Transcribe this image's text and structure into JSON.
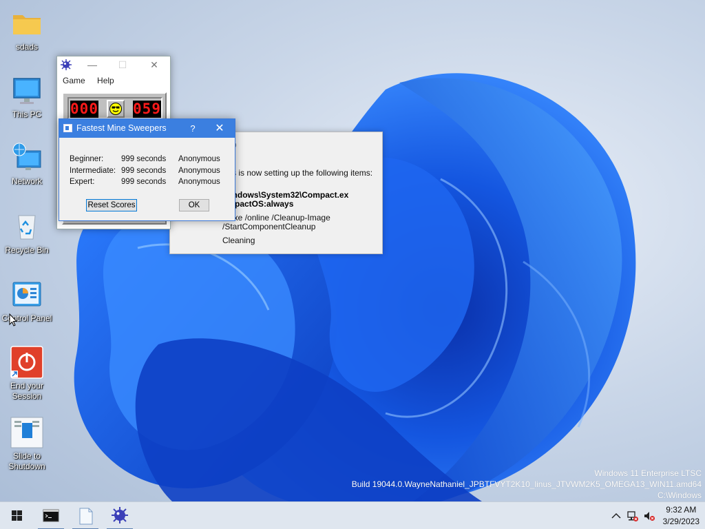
{
  "desktop": {
    "icons": [
      {
        "label": "sdads",
        "icon": "folder-icon"
      },
      {
        "label": "This PC",
        "icon": "monitor-icon"
      },
      {
        "label": "Network",
        "icon": "network-globe-icon"
      },
      {
        "label": "Recycle Bin",
        "icon": "recycle-bin-icon"
      },
      {
        "label": "Control Panel",
        "icon": "control-panel-icon"
      },
      {
        "label": "End your Session",
        "icon": "power-icon"
      },
      {
        "label": "Slide to Shutdown",
        "icon": "slide-shutdown-icon"
      }
    ]
  },
  "minesweeper": {
    "menu": [
      "Game",
      "Help"
    ],
    "mine_counter": "000",
    "timer": "059",
    "face": "cool-smiley-icon"
  },
  "scores_dialog": {
    "title": "Fastest Mine Sweepers",
    "help_glyph": "?",
    "rows": [
      {
        "level": "Beginner:",
        "time": "999 seconds",
        "name": "Anonymous"
      },
      {
        "level": "Intermediate:",
        "time": "999 seconds",
        "name": "Anonymous"
      },
      {
        "level": "Expert:",
        "time": "999 seconds",
        "name": "Anonymous"
      }
    ],
    "reset_label": "Reset Scores",
    "ok_label": "OK"
  },
  "cleanup_dialog": {
    "title_fragment": "p",
    "intro": "s is now setting up the following items:",
    "command1_line1": "Windows\\System32\\Compact.ex",
    "command1_line2": "ompactOS:always",
    "command2_line1": "n.exe /online /Cleanup-Image",
    "command2_line2": "/StartComponentCleanup",
    "status": "Cleaning"
  },
  "watermark": {
    "line1": "Windows 11 Enterprise LTSC",
    "line2": "Build 19044.0.WayneNathaniel_JPBTFVYT2K10_linus_JTVWM2K5_OMEGA13_WIN11.amd64",
    "line3": "C:\\Windows"
  },
  "taskbar": {
    "items": [
      "start-icon",
      "terminal-icon",
      "notepad-icon",
      "minesweeper-icon"
    ],
    "tray": [
      "chevron-up-icon",
      "network-icon",
      "volume-muted-icon"
    ],
    "time": "9:32 AM",
    "date": "3/29/2023"
  },
  "colors": {
    "accent": "#3b7fe0",
    "lcd_red": "#ff1a1a",
    "taskbar": "#dfe6ef"
  }
}
